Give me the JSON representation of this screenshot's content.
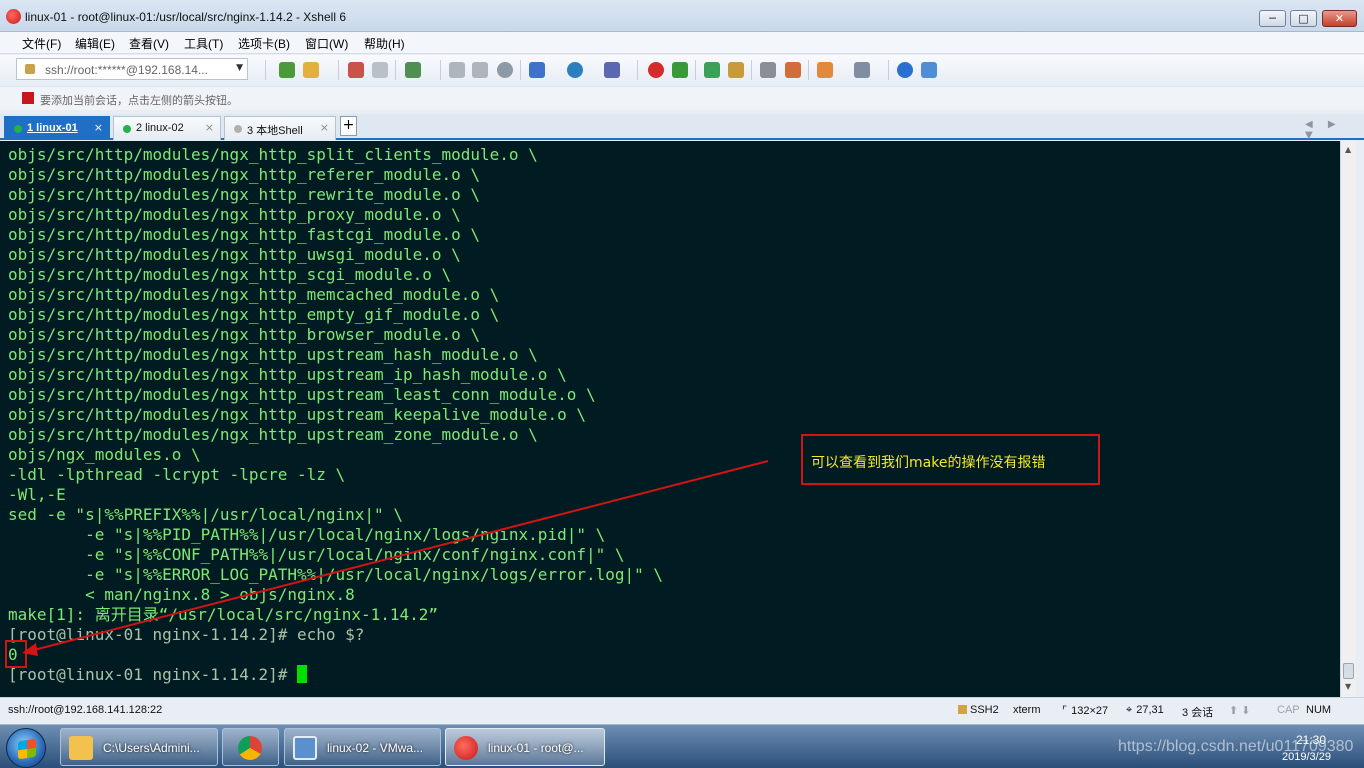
{
  "window": {
    "title": "linux-01 - root@linux-01:/usr/local/src/nginx-1.14.2 - Xshell 6",
    "min_glyph": "─",
    "max_glyph": "□",
    "close_glyph": "✕"
  },
  "menu": [
    "文件(F)",
    "编辑(E)",
    "查看(V)",
    "工具(T)",
    "选项卡(B)",
    "窗口(W)",
    "帮助(H)"
  ],
  "toolbar": {
    "session_address": "ssh://root:******@192.168.14...",
    "dropdown_glyph": "▼"
  },
  "hint": "要添加当前会话，点击左侧的箭头按钮。",
  "tabs": [
    {
      "label": "1 linux-01",
      "status_color": "#22b14c",
      "active": true
    },
    {
      "label": "2 linux-02",
      "status_color": "#22b14c",
      "active": false
    },
    {
      "label": "3 本地Shell",
      "status_color": "#b0b0b0",
      "active": false
    }
  ],
  "tab_close_glyph": "×",
  "tab_add_glyph": "+",
  "tab_nav": "◀ ▶ ▼",
  "terminal": {
    "lines": [
      "objs/src/http/modules/ngx_http_split_clients_module.o \\",
      "objs/src/http/modules/ngx_http_referer_module.o \\",
      "objs/src/http/modules/ngx_http_rewrite_module.o \\",
      "objs/src/http/modules/ngx_http_proxy_module.o \\",
      "objs/src/http/modules/ngx_http_fastcgi_module.o \\",
      "objs/src/http/modules/ngx_http_uwsgi_module.o \\",
      "objs/src/http/modules/ngx_http_scgi_module.o \\",
      "objs/src/http/modules/ngx_http_memcached_module.o \\",
      "objs/src/http/modules/ngx_http_empty_gif_module.o \\",
      "objs/src/http/modules/ngx_http_browser_module.o \\",
      "objs/src/http/modules/ngx_http_upstream_hash_module.o \\",
      "objs/src/http/modules/ngx_http_upstream_ip_hash_module.o \\",
      "objs/src/http/modules/ngx_http_upstream_least_conn_module.o \\",
      "objs/src/http/modules/ngx_http_upstream_keepalive_module.o \\",
      "objs/src/http/modules/ngx_http_upstream_zone_module.o \\",
      "objs/ngx_modules.o \\",
      "-ldl -lpthread -lcrypt -lpcre -lz \\",
      "-Wl,-E",
      "sed -e \"s|%%PREFIX%%|/usr/local/nginx|\" \\",
      "        -e \"s|%%PID_PATH%%|/usr/local/nginx/logs/nginx.pid|\" \\",
      "        -e \"s|%%CONF_PATH%%|/usr/local/nginx/conf/nginx.conf|\" \\",
      "        -e \"s|%%ERROR_LOG_PATH%%|/usr/local/nginx/logs/error.log|\" \\",
      "        < man/nginx.8 > objs/nginx.8",
      "make[1]: 离开目录“/usr/local/src/nginx-1.14.2”",
      "[root@linux-01 nginx-1.14.2]# echo $?",
      "0"
    ],
    "prompt": "[root@linux-01 nginx-1.14.2]# "
  },
  "annotation": {
    "text": "可以查看到我们make的操作没有报错",
    "color": "#d11414"
  },
  "status": {
    "connection": "ssh://root@192.168.141.128:22",
    "protocol": "SSH2",
    "terminal_type": "xterm",
    "size": "132×27",
    "cursor_pos": "27,31",
    "sessions": "3 会话",
    "caps": "CAP",
    "num": "NUM"
  },
  "taskbar": {
    "items": [
      {
        "label": "C:\\Users\\Admini..."
      },
      {
        "label": "linux-02 - VMwa..."
      },
      {
        "label": "linux-01 - root@..."
      }
    ],
    "time": "21:30",
    "date": "2019/3/29",
    "watermark": "https://blog.csdn.net/u011709380"
  }
}
